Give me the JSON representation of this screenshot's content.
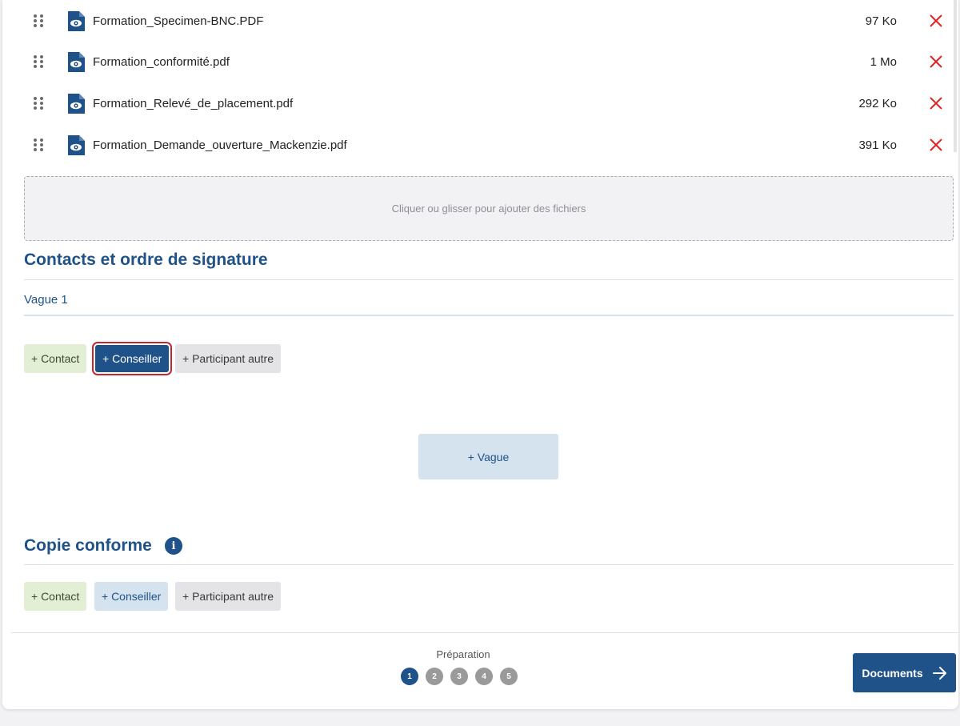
{
  "files": [
    {
      "name": "Formation_Specimen-BNC.PDF",
      "size": "97 Ko"
    },
    {
      "name": "Formation_conformité.pdf",
      "size": "1 Mo"
    },
    {
      "name": "Formation_Relevé_de_placement.pdf",
      "size": "292 Ko"
    },
    {
      "name": "Formation_Demande_ouverture_Mackenzie.pdf",
      "size": "391 Ko"
    }
  ],
  "dropzone": {
    "label": "Cliquer ou glisser pour ajouter des fichiers"
  },
  "signature": {
    "title": "Contacts et ordre de signature",
    "wave_label": "Vague 1",
    "buttons": {
      "contact": "+ Contact",
      "conseiller": "+ Conseiller",
      "autre": "+ Participant autre"
    },
    "add_wave": "+ Vague"
  },
  "copy": {
    "title": "Copie conforme",
    "info_icon": "i",
    "buttons": {
      "contact": "+ Contact",
      "conseiller": "+ Conseiller",
      "autre": "+ Participant autre"
    }
  },
  "footer": {
    "step_label": "Préparation",
    "steps": [
      "1",
      "2",
      "3",
      "4",
      "5"
    ],
    "active_step": "1",
    "next_label": "Documents"
  },
  "colors": {
    "primary": "#1e5288",
    "delete": "#e02424",
    "contact": "#e3efd4",
    "highlight": "#c4282b"
  }
}
